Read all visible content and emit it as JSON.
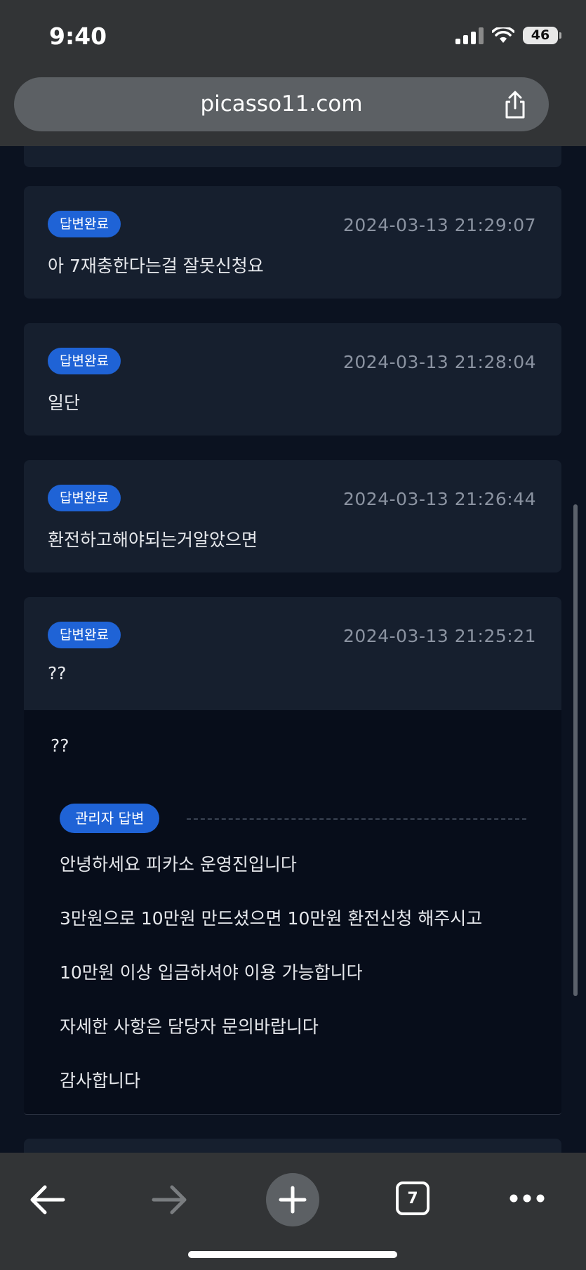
{
  "status": {
    "time": "9:40",
    "battery": "46"
  },
  "browser": {
    "url": "picasso11.com",
    "tab_count": "7"
  },
  "inquiries": [
    {
      "badge": "답변완료",
      "date": "2024-03-13 21:29:07",
      "message": "아 7재충한다는걸 잘못신청요"
    },
    {
      "badge": "답변완료",
      "date": "2024-03-13 21:28:04",
      "message": "일단"
    },
    {
      "badge": "답변완료",
      "date": "2024-03-13 21:26:44",
      "message": "환전하고해야되는거알았으면"
    },
    {
      "badge": "답변완료",
      "date": "2024-03-13 21:25:21",
      "message": "??"
    }
  ],
  "expanded": {
    "question": "??",
    "admin_label": "관리자 답변",
    "reply_lines": [
      "안녕하세요 피카소 운영진입니다",
      "3만원으로 10만원 만드셨으면 10만원 환전신청 해주시고",
      "10만원 이상 입금하셔야 이용 가능합니다",
      "자세한 사항은 담당자 문의바랍니다",
      "감사합니다"
    ]
  },
  "icons": {
    "back": "arrow-left-icon",
    "forward": "arrow-right-icon",
    "new_tab": "plus-icon",
    "tabs": "tabs-icon",
    "more": "more-icon",
    "share": "share-icon"
  }
}
